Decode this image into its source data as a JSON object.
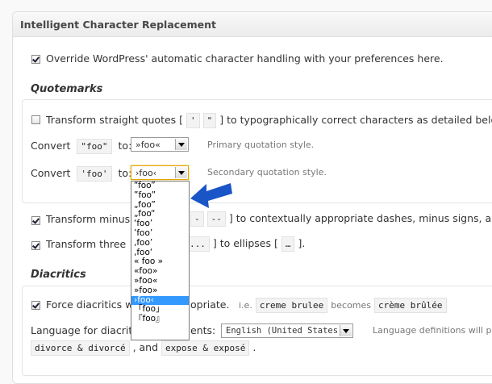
{
  "panel": {
    "title": "Intelligent Character Replacement"
  },
  "override": {
    "checked": true,
    "label": "Override WordPress' automatic character handling with your preferences here."
  },
  "quotemarks": {
    "title": "Quotemarks",
    "transform": {
      "checked": false,
      "prefix": "Transform straight quotes [",
      "code1": "'",
      "code2": "\"",
      "suffix": "] to typographically correct characters as detailed belo"
    },
    "primary": {
      "convert": "Convert",
      "code": "\"foo\"",
      "to": "to:",
      "value": "»foo«",
      "description": "Primary quotation style."
    },
    "secondary": {
      "convert": "Convert",
      "code": "'foo'",
      "to": "to:",
      "value": "›foo‹",
      "description": "Secondary quotation style."
    },
    "options": [
      "“foo”",
      "”foo”",
      "„foo”",
      "„foo“",
      "‘foo’",
      "’foo’",
      "‚foo’",
      "‚foo‘",
      "« foo »",
      "«foo»",
      "»foo«",
      "»foo»",
      "›foo‹",
      "「foo」",
      "『foo』"
    ],
    "selected_index": 12
  },
  "dashes": {
    "checked": true,
    "prefix": "Transform minus",
    "code1": "-",
    "code2": "--",
    "suffix": "] to contextually appropriate dashes, minus signs, an"
  },
  "ellipses": {
    "checked": true,
    "prefix": "Transform three",
    "code1": "...",
    "middle": "] to ellipses [",
    "code2": "…",
    "suffix": "]."
  },
  "diacritics": {
    "title": "Diacritics",
    "force": {
      "checked": true,
      "label_a": "Force diacritics w",
      "label_b": "opriate.",
      "ie": "i.e.",
      "code_from": "creme brulee",
      "becomes": "becomes",
      "code_to": "crème brûlée"
    },
    "language": {
      "label_a": "Language for diacrit",
      "label_b": "ents:",
      "value": "English (United States)",
      "description": "Language definitions will p"
    },
    "examples": {
      "code1": "divorce & divorcé",
      "sep": ", and",
      "code2": "expose & exposé",
      "end": "."
    }
  },
  "colors": {
    "arrow": "#1a55c8",
    "selected": "#3399ff"
  }
}
